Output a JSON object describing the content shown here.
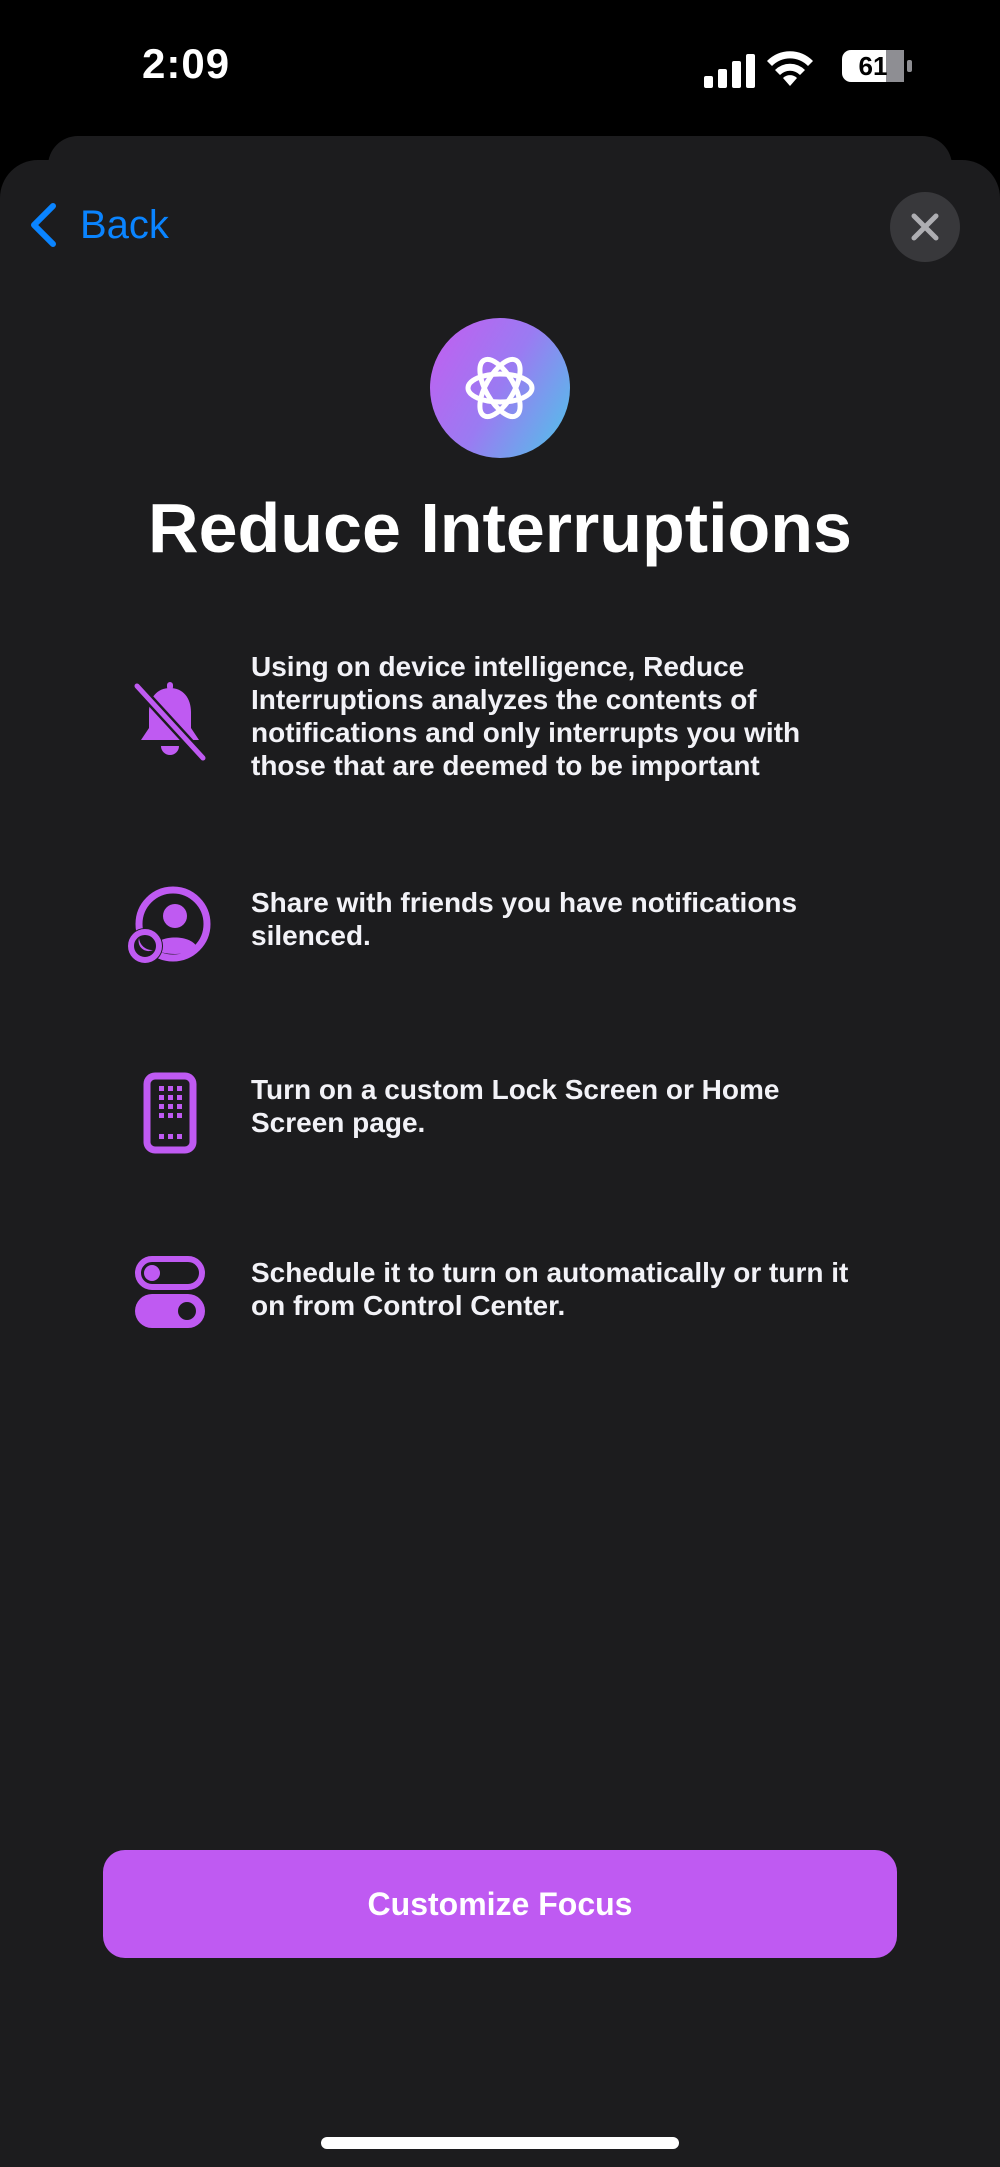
{
  "status_bar": {
    "time": "2:09",
    "battery_level": "61"
  },
  "nav": {
    "back_label": "Back"
  },
  "title": "Reduce Interruptions",
  "features": [
    {
      "icon": "bell-slash-icon",
      "text": "Using on device intelligence, Reduce Interruptions analyzes the contents of notifications and only interrupts you with those that are deemed to be important"
    },
    {
      "icon": "person-moon-icon",
      "text": "Share with friends you have notifications silenced."
    },
    {
      "icon": "phone-grid-icon",
      "text": "Turn on a custom Lock Screen or Home Screen page."
    },
    {
      "icon": "toggles-icon",
      "text": "Schedule it to turn on automatically or turn it on from Control Center."
    }
  ],
  "cta_label": "Customize Focus",
  "colors": {
    "accent": "#bf5af2",
    "link": "#0a84ff",
    "sheet": "#1c1c1e"
  }
}
